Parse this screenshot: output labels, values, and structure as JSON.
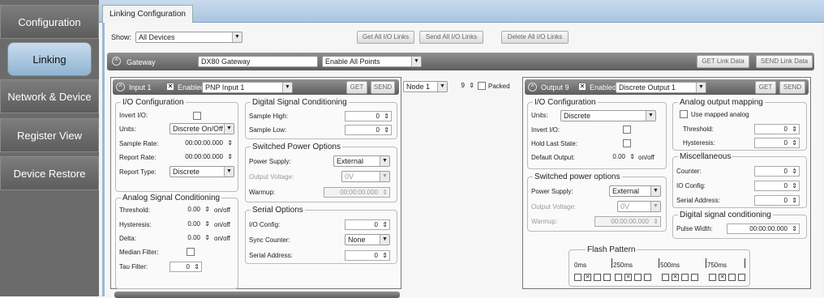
{
  "nav": {
    "items": [
      "Configuration",
      "Linking",
      "Network & Device",
      "Register View",
      "Device Restore"
    ]
  },
  "tab": {
    "label": "Linking Configuration"
  },
  "show": {
    "label": "Show:",
    "value": "All Devices"
  },
  "top_buttons": {
    "get_all": "Get All I/O Links",
    "send_all": "Send All I/O Links",
    "delete_all": "Delete All I/O Links"
  },
  "gateway": {
    "label": "Gateway",
    "name": "DX80 Gateway",
    "mode": "Enable All Points",
    "get": "GET Link Data",
    "send": "SEND Link Data"
  },
  "input": {
    "title": "Input 1",
    "enabled": "Enabled",
    "type": "PNP Input 1",
    "get": "GET",
    "send": "SEND",
    "io": {
      "legend": "I/O Configuration",
      "invert": "Invert I/O:",
      "units": "Units:",
      "units_val": "Discrete On/Off",
      "rate": "Sample Rate:",
      "rate_val": "00:00:00.000",
      "report_rate": "Report Rate:",
      "report_rate_val": "00:00:00.000",
      "report_type": "Report Type:",
      "report_type_val": "Discrete"
    },
    "analog": {
      "legend": "Analog Signal Conditioning",
      "threshold": "Threshold:",
      "threshold_val": "0.00",
      "hysteresis": "Hysteresis:",
      "hysteresis_val": "0.00",
      "delta": "Delta:",
      "delta_val": "0.00",
      "unit": "on/off",
      "median": "Median Filter:",
      "tau": "Tau Filter:",
      "tau_val": "0"
    },
    "digital": {
      "legend": "Digital Signal Conditioning",
      "high": "Sample High:",
      "high_val": "0",
      "low": "Sample Low:",
      "low_val": "0"
    },
    "power": {
      "legend": "Switched Power Options",
      "supply": "Power Supply:",
      "supply_val": "External",
      "voltage": "Output Voltage:",
      "voltage_val": "0V",
      "warmup": "Warmup:",
      "warmup_val": "00:00:00.000"
    },
    "serial": {
      "legend": "Serial Options",
      "io_config": "I/O Config:",
      "io_config_val": "0",
      "sync": "Sync Counter:",
      "sync_val": "None",
      "address": "Serial Address:",
      "address_val": "0"
    }
  },
  "link": {
    "node": "Node 1",
    "num": "9",
    "packed": "Packed"
  },
  "output": {
    "title": "Output 9",
    "enabled": "Enabled",
    "type": "Discrete Output 1",
    "get": "GET",
    "send": "SEND",
    "io": {
      "legend": "I/O Configuration",
      "units": "Units:",
      "units_val": "Discrete",
      "invert": "Invert I/O:",
      "hold": "Hold Last State:",
      "default": "Default Output:",
      "default_val": "0.00",
      "unit": "on/off"
    },
    "power": {
      "legend": "Switched power options",
      "supply": "Power Supply:",
      "supply_val": "External",
      "voltage": "Output Voltage:",
      "voltage_val": "0V",
      "warmup": "Warmup:",
      "warmup_val": "00:00:00.000"
    },
    "analog": {
      "legend": "Analog output mapping",
      "use": "Use mapped analog",
      "threshold": "Threshold:",
      "threshold_val": "0",
      "hysteresis": "Hysteresis:",
      "hysteresis_val": "0"
    },
    "misc": {
      "legend": "Miscellaneous",
      "counter": "Counter:",
      "counter_val": "0",
      "io_config": "IO Config:",
      "io_config_val": "0",
      "address": "Serial Address:",
      "address_val": "0"
    },
    "digital": {
      "legend": "Digital signal conditioning",
      "pulse": "Pulse Width:",
      "pulse_val": "00:00:00.000"
    },
    "flash": {
      "legend": "Flash Pattern",
      "t0": "0ms",
      "t1": "250ms",
      "t2": "500ms",
      "t3": "750ms"
    }
  }
}
